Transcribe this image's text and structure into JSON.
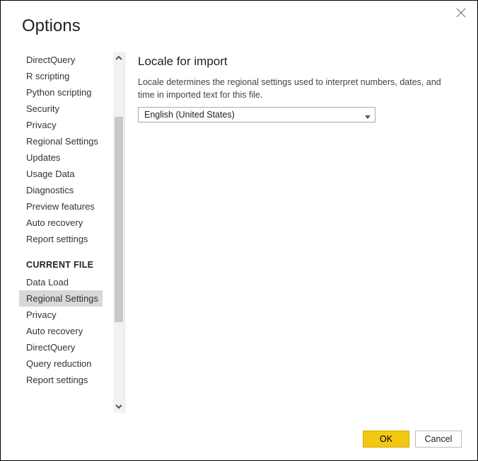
{
  "dialog": {
    "title": "Options"
  },
  "sidebar": {
    "items_top": [
      {
        "label": "DirectQuery"
      },
      {
        "label": "R scripting"
      },
      {
        "label": "Python scripting"
      },
      {
        "label": "Security"
      },
      {
        "label": "Privacy"
      },
      {
        "label": "Regional Settings"
      },
      {
        "label": "Updates"
      },
      {
        "label": "Usage Data"
      },
      {
        "label": "Diagnostics"
      },
      {
        "label": "Preview features"
      },
      {
        "label": "Auto recovery"
      },
      {
        "label": "Report settings"
      }
    ],
    "section_header": "CURRENT FILE",
    "items_current": [
      {
        "label": "Data Load"
      },
      {
        "label": "Regional Settings",
        "selected": true
      },
      {
        "label": "Privacy"
      },
      {
        "label": "Auto recovery"
      },
      {
        "label": "DirectQuery"
      },
      {
        "label": "Query reduction"
      },
      {
        "label": "Report settings"
      }
    ]
  },
  "main": {
    "heading": "Locale for import",
    "description": "Locale determines the regional settings used to interpret numbers, dates, and time in imported text for this file.",
    "locale_selected": "English (United States)"
  },
  "footer": {
    "ok_label": "OK",
    "cancel_label": "Cancel"
  }
}
